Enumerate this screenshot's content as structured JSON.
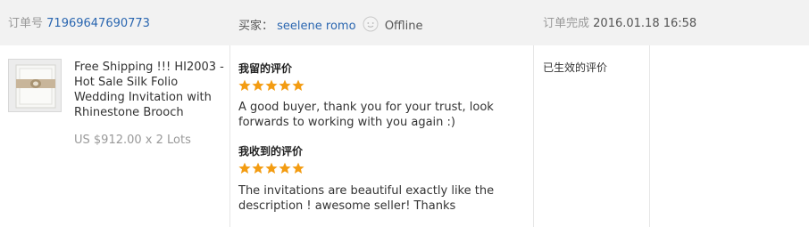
{
  "order": {
    "number_label": "订单号",
    "number": "71969647690773",
    "buyer_label": "买家：",
    "buyer_name": "seelene romo",
    "buyer_status": "Offline",
    "complete_label": "订单完成",
    "complete_time": "2016.01.18 16:58"
  },
  "product": {
    "title": "Free Shipping !!! HI2003 - Hot Sale Silk Folio Wedding Invitation with Rhinestone Brooch",
    "price": "US $912.00 x 2 Lots"
  },
  "feedback_left": {
    "heading": "我留的评价",
    "stars": 5,
    "text": "A good buyer, thank you for your trust, look forwards to working with you again :)"
  },
  "feedback_received": {
    "heading": "我收到的评价",
    "stars": 5,
    "text": "The invitations are beautiful exactly like the description ! awesome seller! Thanks"
  },
  "status": "已生效的评价",
  "colors": {
    "header_bg": "#f2f2f2",
    "link": "#2a66b0",
    "star": "#f39c12",
    "muted": "#999999"
  }
}
